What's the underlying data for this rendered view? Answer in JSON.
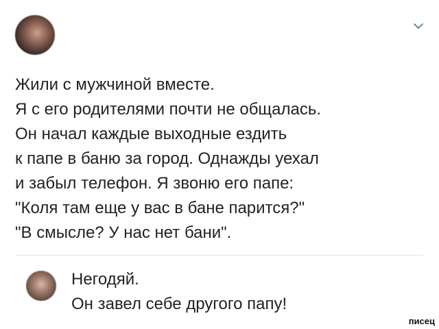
{
  "post": {
    "author_name": "",
    "author_meta": "",
    "text": "Жили с мужчиной вместе.\nЯ с его родителями почти не общалась.\nОн начал каждые выходные ездить\nк папе в баню за город. Однажды уехал\nи забыл телефон. Я звоню его папе:\n\"Коля там еще у вас в бане парится?\"\n\"В смысле? У нас нет бани\"."
  },
  "icons": {
    "menu": "chevron-down-icon"
  },
  "comment": {
    "text": "Негодяй.\nОн завел себе другого папу!"
  },
  "watermark": "писец",
  "colors": {
    "text": "#222222",
    "background": "#ffffff",
    "divider": "#e6e6e6",
    "chevron": "#4a76a8"
  }
}
